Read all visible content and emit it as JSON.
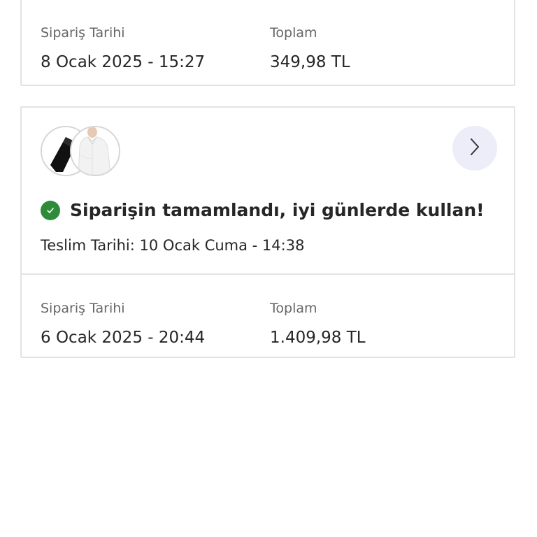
{
  "orders": [
    {
      "order_date_label": "Sipariş Tarihi",
      "order_date": "8 Ocak 2025 - 15:27",
      "total_label": "Toplam",
      "total": "349,98 TL"
    },
    {
      "thumbnails": [
        "black-tie-icon",
        "white-shirt-icon"
      ],
      "status_text": "Siparişin tamamlandı, iyi günlerde kullan!",
      "delivery_label": "Teslim Tarihi:",
      "delivery_date": "10 Ocak Cuma - 14:38",
      "order_date_label": "Sipariş Tarihi",
      "order_date": "6 Ocak 2025 - 20:44",
      "total_label": "Toplam",
      "total": "1.409,98 TL"
    }
  ],
  "colors": {
    "status_success": "#2e8b3a",
    "arrow_button_bg": "#ecedf8",
    "card_border": "#e3e3e3"
  },
  "icons": {
    "status": "check-circle-icon",
    "details": "chevron-right-icon"
  }
}
